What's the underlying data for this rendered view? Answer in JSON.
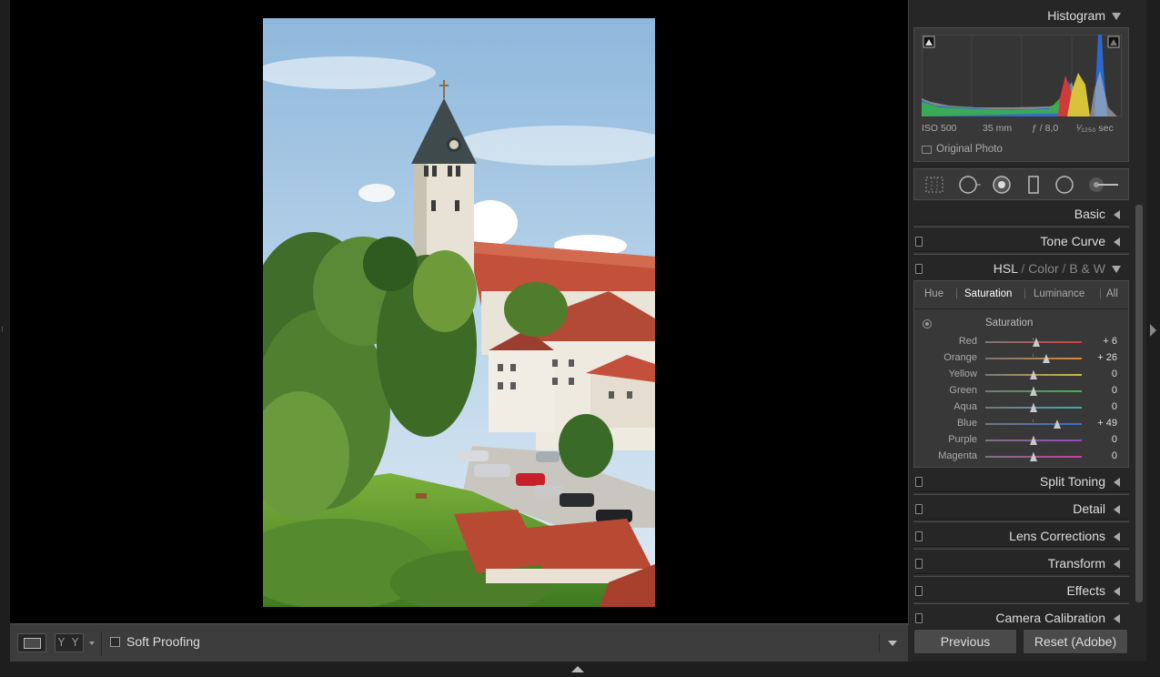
{
  "panels": {
    "histogram": {
      "title": "Histogram",
      "iso": "ISO 500",
      "focal": "35 mm",
      "aperture": "ƒ / 8,0",
      "shutter": "¹⁄₁₂₅₀ sec",
      "original_photo": "Original Photo"
    },
    "basic": "Basic",
    "tone_curve": "Tone Curve",
    "hsl": {
      "title_hsl": "HSL",
      "sep": "/",
      "title_color": "Color",
      "title_bw": "B & W",
      "tabs": [
        "Hue",
        "Saturation",
        "Luminance",
        "All"
      ],
      "tab_sep": "|",
      "active_tab": "Saturation",
      "section_title": "Saturation",
      "sliders": [
        {
          "label": "Red",
          "value": "+ 6",
          "num": 6,
          "color": "#d04040"
        },
        {
          "label": "Orange",
          "value": "+ 26",
          "num": 26,
          "color": "#d98a3a"
        },
        {
          "label": "Yellow",
          "value": "0",
          "num": 0,
          "color": "#cdbb40"
        },
        {
          "label": "Green",
          "value": "0",
          "num": 0,
          "color": "#40b050"
        },
        {
          "label": "Aqua",
          "value": "0",
          "num": 0,
          "color": "#35b3a8"
        },
        {
          "label": "Blue",
          "value": "+ 49",
          "num": 49,
          "color": "#3a6ed0"
        },
        {
          "label": "Purple",
          "value": "0",
          "num": 0,
          "color": "#9a45c8"
        },
        {
          "label": "Magenta",
          "value": "0",
          "num": 0,
          "color": "#cc3aa8"
        }
      ]
    },
    "split_toning": "Split Toning",
    "detail": "Detail",
    "lens_corrections": "Lens Corrections",
    "transform": "Transform",
    "effects": "Effects",
    "camera_calibration": "Camera Calibration"
  },
  "toolbar": {
    "yy": "Y Y",
    "soft_proofing": "Soft Proofing"
  },
  "buttons": {
    "previous": "Previous",
    "reset": "Reset (Adobe)"
  },
  "colors": {
    "panel_bg": "#262626",
    "canvas_bg": "#000000"
  }
}
